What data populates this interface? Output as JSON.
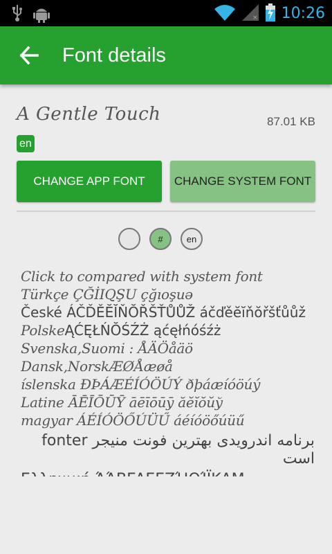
{
  "statusbar": {
    "time": "10:26",
    "icons": [
      "usb-icon",
      "android-debug-icon",
      "wifi-icon",
      "cell-signal-icon",
      "battery-charging-icon"
    ]
  },
  "appbar": {
    "title": "Font details",
    "back_icon": "arrow-back-icon"
  },
  "font": {
    "name": "A Gentle Touch",
    "size": "87.01 KB",
    "language": "en"
  },
  "buttons": {
    "change_app_font": "CHANGE APP FONT",
    "change_system_font": "CHANGE SYSTEM FONT"
  },
  "toggles": [
    {
      "label": ""
    },
    {
      "label": "#"
    },
    {
      "label": "en"
    }
  ],
  "samples": {
    "compare_hint": "Click to compared with system font",
    "turkish_label": "Türkçe",
    "turkish_chars": "ÇĞİIQŞU çğıoşuə",
    "czech_label": "České",
    "czech_chars": "ÁČĎĚĔĬŇŎŘŠŤŮŮŽ áčďěĕĭňŏřšťůůž",
    "polish_label": "Polske",
    "polish_chars": "ĄĆĘŁŃŎŚŹŻ ąćęłńóśźż",
    "swedish_label": "Svenska,Suomi :",
    "swedish_chars": "ÅÄÖåäö",
    "danish_label": "Dansk,Norsk",
    "danish_chars": "ÆØÅæøå",
    "icelandic_label": "íslenska",
    "icelandic_chars": "ÐÞÁÆÉÍÓÖÚÝ ðþáæíóöúý",
    "latin_label": "Latine",
    "latin_chars": "ĀĒĪŌŪȲ āēīōūȳ ăĕĭŏŭў",
    "hungarian_label": "magyar",
    "hungarian_chars": "ÁÉÍÓÖŐÚÜŰ áéíóöőúüű",
    "persian": "برنامه اندرویدی بهترین فونت منیجر fonter است",
    "greek": "Ελληνική ΆΆΒΓΔΕΕΖΉΘΊΪΚΛΜ"
  }
}
